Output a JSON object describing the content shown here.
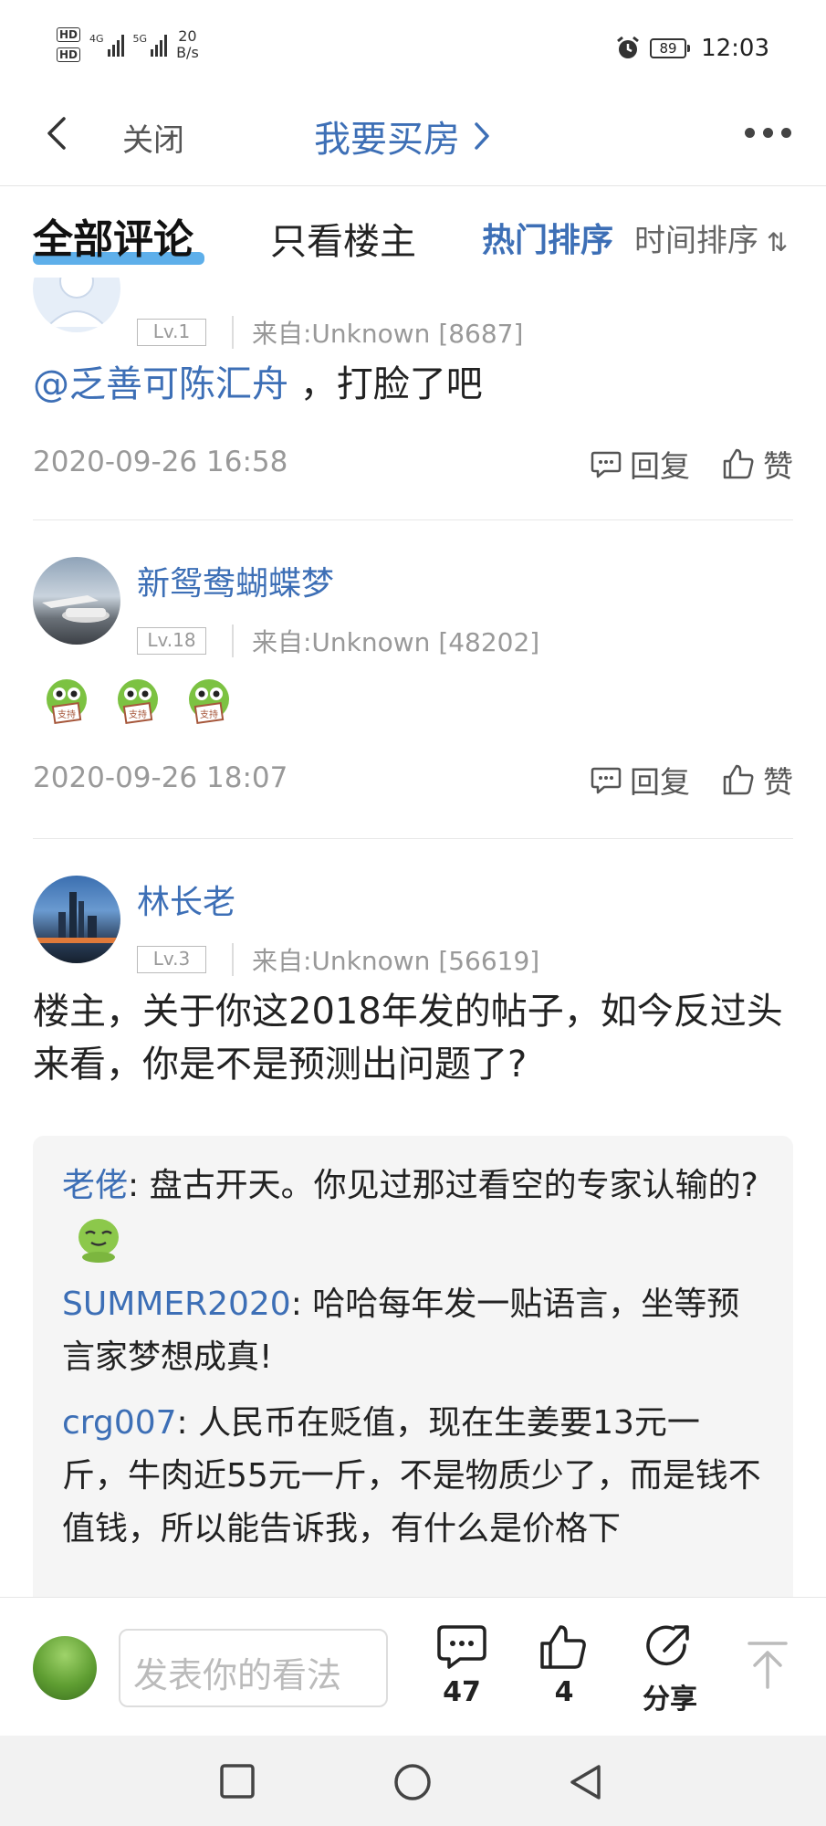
{
  "status_bar": {
    "hd1": "HD",
    "hd2": "HD",
    "net1": "4G",
    "net2": "5G",
    "speed_value": "20",
    "speed_unit": "B/s",
    "battery": "89",
    "time": "12:03"
  },
  "title_bar": {
    "close_label": "关闭",
    "title": "我要买房"
  },
  "tabs": {
    "all_comments": "全部评论",
    "owner_only": "只看楼主",
    "sort_hot": "热门排序",
    "sort_time": "时间排序"
  },
  "comments": [
    {
      "level": "Lv.1",
      "source": "来自:Unknown [8687]",
      "mention": "@乏善可陈汇舟",
      "text": " ，打脸了吧",
      "time": "2020-09-26 16:58",
      "reply_label": "回复",
      "like_label": "赞"
    },
    {
      "username": "新鸳鸯蝴蝶梦",
      "level": "Lv.18",
      "source": "来自:Unknown [48202]",
      "stickers": [
        "支持",
        "支持",
        "支持"
      ],
      "time": "2020-09-26 18:07",
      "reply_label": "回复",
      "like_label": "赞"
    },
    {
      "username": "林长老",
      "level": "Lv.3",
      "source": "来自:Unknown [56619]",
      "text": "楼主，关于你这2018年发的帖子，如今反过头来看，你是不是预测出问题了?",
      "replies": [
        {
          "user": "老佬",
          "text": ": 盘古开天。你见过那过看空的专家认输的?"
        },
        {
          "user": "SUMMER2020",
          "text": ": 哈哈每年发一贴语言，坐等预言家梦想成真!"
        },
        {
          "user": "crg007",
          "text": ": 人民币在贬值，现在生姜要13元一斤，牛肉近55元一斤，不是物质少了，而是钱不值钱，所以能告诉我，有什么是价格下"
        }
      ]
    }
  ],
  "bottom_bar": {
    "input_placeholder": "发表你的看法",
    "comment_count": "47",
    "like_count": "4",
    "share_label": "分享"
  },
  "colors": {
    "accent": "#3d6fb6",
    "tab_underline": "#4da6e8",
    "meta_gray": "#999999"
  }
}
